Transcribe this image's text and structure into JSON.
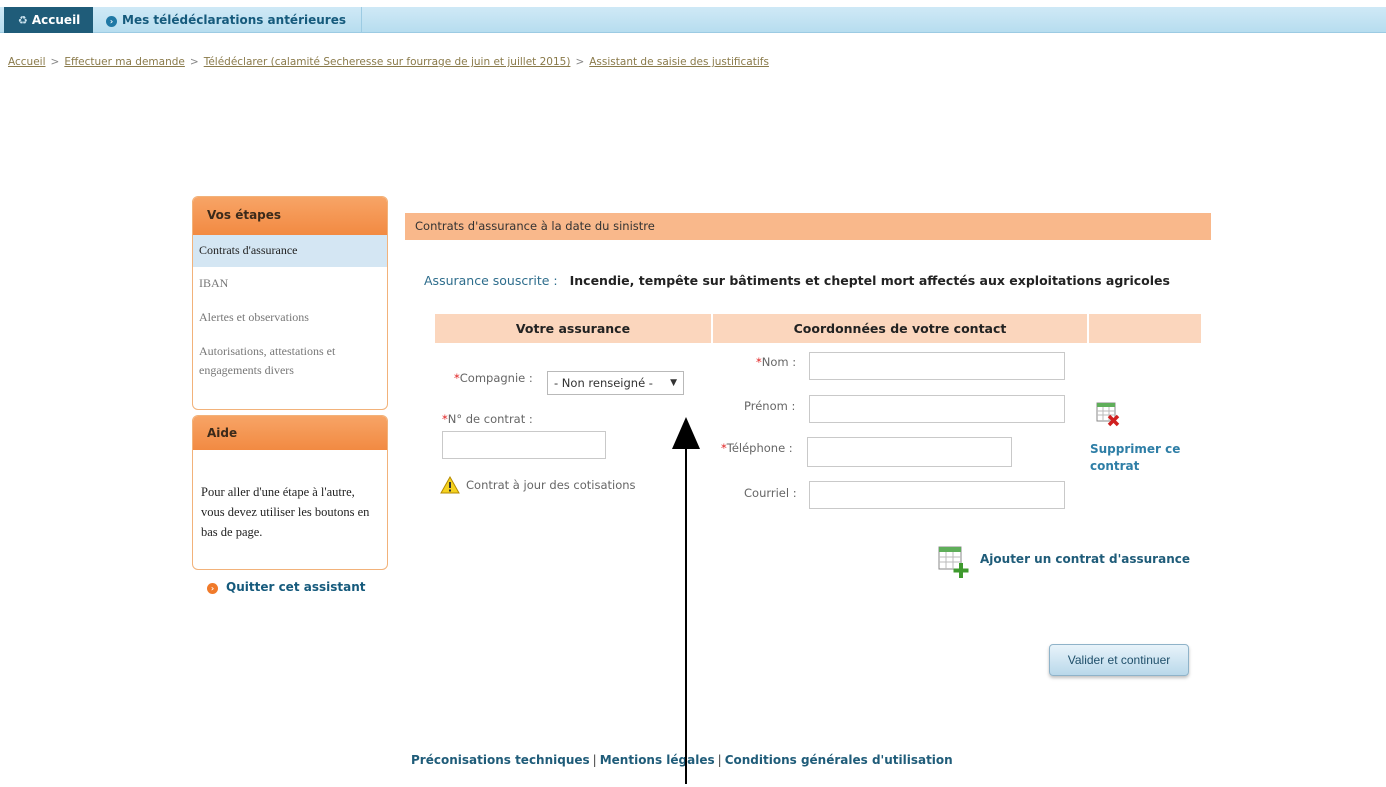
{
  "topnav": {
    "home_label": "Accueil",
    "previous_label": "Mes télédéclarations antérieures"
  },
  "breadcrumb": [
    "Accueil",
    "Effectuer ma demande",
    "Télédéclarer (calamité Secheresse sur fourrage de juin et juillet 2015)",
    "Assistant de saisie des justificatifs"
  ],
  "steps": {
    "title": "Vos étapes",
    "items": [
      "Contrats d'assurance",
      "IBAN",
      "Alertes et observations",
      "Autorisations, attestations et engagements divers"
    ]
  },
  "help": {
    "title": "Aide",
    "text": "Pour aller d'une étape à l'autre, vous devez utiliser les boutons en bas de page."
  },
  "quit_label": "Quitter cet assistant",
  "section_title": "Contrats d'assurance à la date du sinistre",
  "insurance": {
    "label": "Assurance souscrite :",
    "value": "Incendie, tempête sur bâtiments et cheptel mort affectés aux exploitations agricoles"
  },
  "columns": [
    "Votre assurance",
    "Coordonnées de votre contact",
    ""
  ],
  "form": {
    "company_label": "Compagnie :",
    "company_value": "- Non renseigné -",
    "contract_label": "N° de contrat :",
    "contract_value": "",
    "nom_label": "Nom :",
    "prenom_label": "Prénom :",
    "telephone_label": "Téléphone :",
    "courriel_label": "Courriel :",
    "required_mark": "*"
  },
  "warning_text": "Contrat à jour des cotisations",
  "delete_label": "Supprimer ce contrat",
  "add_label": "Ajouter un contrat d'assurance",
  "validate_label": "Valider et continuer",
  "footer": {
    "links": [
      "Préconisations techniques",
      "Mentions légales",
      "Conditions générales d'utilisation"
    ],
    "separator": "|"
  },
  "colors": {
    "accent_orange": "#f28a42",
    "nav_blue": "#1f5c79",
    "header_peach": "#f9b88b",
    "required_red": "#e02020"
  }
}
